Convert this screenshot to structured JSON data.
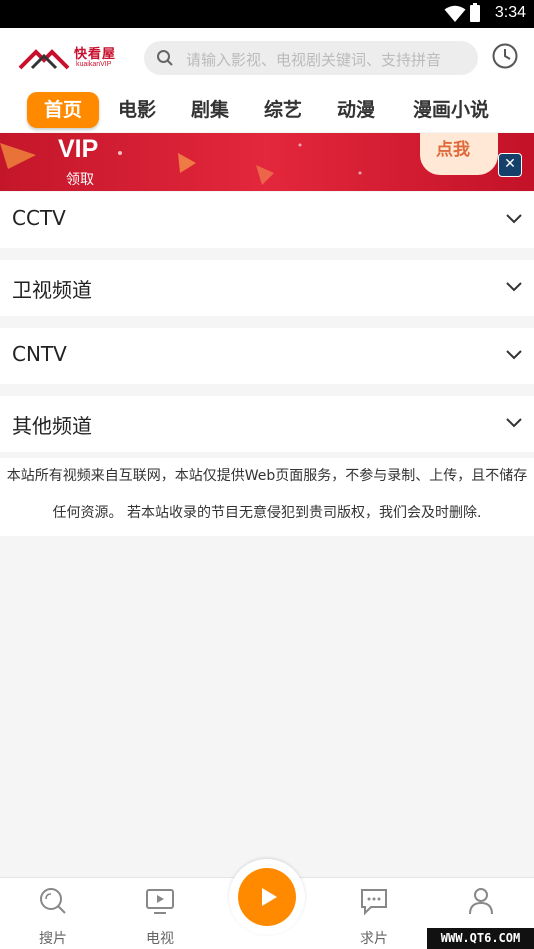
{
  "status_bar": {
    "time": "3:34",
    "icons": [
      "wifi-icon",
      "battery-icon"
    ]
  },
  "header": {
    "logo_text": "快看屋",
    "logo_subtext": "kuaikanVIP",
    "search_placeholder": "请输入影视、电视剧关键词、支持拼音",
    "history_icon": "clock-icon"
  },
  "tabs": [
    {
      "label": "首页",
      "active": true
    },
    {
      "label": "电影",
      "active": false
    },
    {
      "label": "剧集",
      "active": false
    },
    {
      "label": "综艺",
      "active": false
    },
    {
      "label": "动漫",
      "active": false
    },
    {
      "label": "漫画小说",
      "active": false
    }
  ],
  "banner": {
    "vip": "VIP",
    "claim": "领取",
    "cta": "点我",
    "close_icon": "close-icon"
  },
  "categories": [
    {
      "label": "CCTV"
    },
    {
      "label": "卫视频道"
    },
    {
      "label": "CNTV"
    },
    {
      "label": "其他频道"
    }
  ],
  "notice": "本站所有视频来自互联网，本站仅提供Web页面服务，不参与录制、上传，且不储存任何资源。 若本站收录的节目无意侵犯到贵司版权，我们会及时删除.",
  "bottom_nav": [
    {
      "label": "搜片",
      "icon": "search-icon"
    },
    {
      "label": "电视",
      "icon": "tv-icon"
    },
    {
      "label": "",
      "icon": "play-icon"
    },
    {
      "label": "求片",
      "icon": "message-icon"
    },
    {
      "label": "",
      "icon": "user-icon"
    }
  ],
  "watermark": "WWW.QT6.COM",
  "colors": {
    "accent": "#ff8a00",
    "banner_red": "#d41c32"
  }
}
